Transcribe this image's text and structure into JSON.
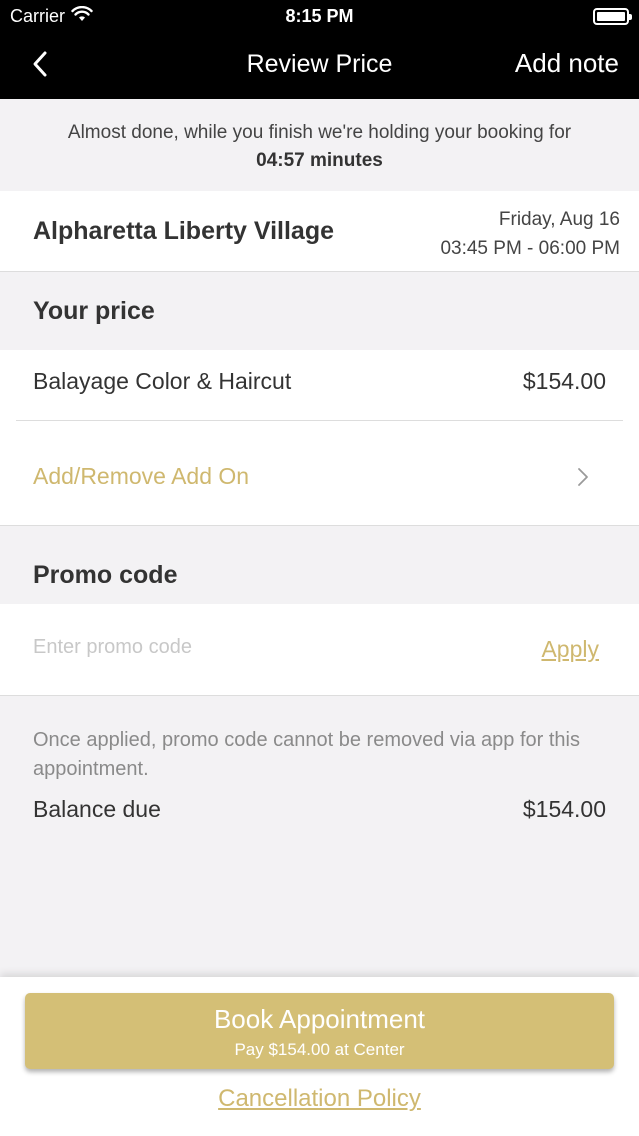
{
  "status_bar": {
    "carrier": "Carrier",
    "time": "8:15 PM",
    "wifi_icon": "wifi-icon",
    "battery_icon": "battery-icon"
  },
  "nav": {
    "back_icon": "chevron-left-icon",
    "title": "Review Price",
    "action": "Add note"
  },
  "hold_banner": {
    "message": "Almost done, while you finish we're holding your booking for",
    "countdown": "04:57 minutes"
  },
  "salon": {
    "name": "Alpharetta Liberty Village",
    "date": "Friday, Aug 16",
    "time_range": "03:45 PM - 06:00 PM"
  },
  "price_section": {
    "heading": "Your price",
    "service_name": "Balayage Color & Haircut",
    "service_price": "$154.00",
    "addon_label": "Add/Remove Add On",
    "addon_icon": "chevron-right-icon"
  },
  "promo_section": {
    "heading": "Promo code",
    "placeholder": "Enter promo code",
    "value": "",
    "apply_label": "Apply",
    "note": "Once applied, promo code cannot be removed via app for this appointment."
  },
  "balance": {
    "label": "Balance due",
    "value": "$154.00"
  },
  "footer": {
    "book_label": "Book Appointment",
    "book_sub": "Pay $154.00 at Center",
    "cancellation_label": "Cancellation Policy"
  },
  "colors": {
    "accent": "#d4bf76",
    "link": "#cfb86f",
    "header_bg": "#000000",
    "page_bg": "#f3f2f4"
  }
}
